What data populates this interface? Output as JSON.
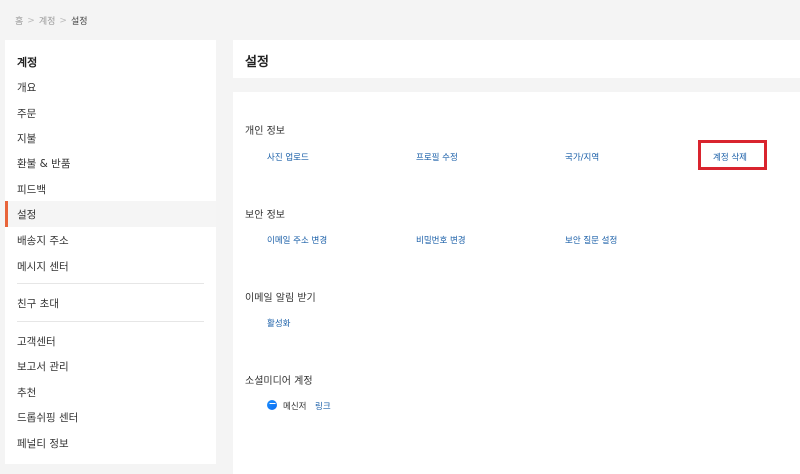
{
  "breadcrumb": {
    "home": "홈",
    "sep": ">",
    "account": "계정",
    "current": "설정"
  },
  "sidebar": {
    "heading": "계정",
    "items": [
      "개요",
      "주문",
      "지불",
      "환불 & 반품",
      "피드백",
      "설정",
      "배송지 주소",
      "메시지 센터",
      "친구 초대",
      "고객센터",
      "보고서 관리",
      "추천",
      "드롭쉬핑 센터",
      "페널티 정보"
    ],
    "active_index": 5,
    "accent_color": "#e8643a"
  },
  "main": {
    "title": "설정",
    "sections": {
      "personal": {
        "title": "개인 정보",
        "links": [
          "사진 업로드",
          "프로필 수정",
          "국가/지역",
          "계정 삭제"
        ]
      },
      "security": {
        "title": "보안 정보",
        "links": [
          "이메일 주소 변경",
          "비밀번호 변경",
          "보안 질문 설정"
        ]
      },
      "email_alert": {
        "title": "이메일 알림 받기",
        "links": [
          "활성화"
        ]
      },
      "social": {
        "title": "소셜미디어 계정",
        "messenger_label": "메신저",
        "messenger_link": "링크",
        "icon": "messenger-icon"
      }
    },
    "link_color": "#1a5fa8",
    "highlight_color": "#d9242e"
  }
}
